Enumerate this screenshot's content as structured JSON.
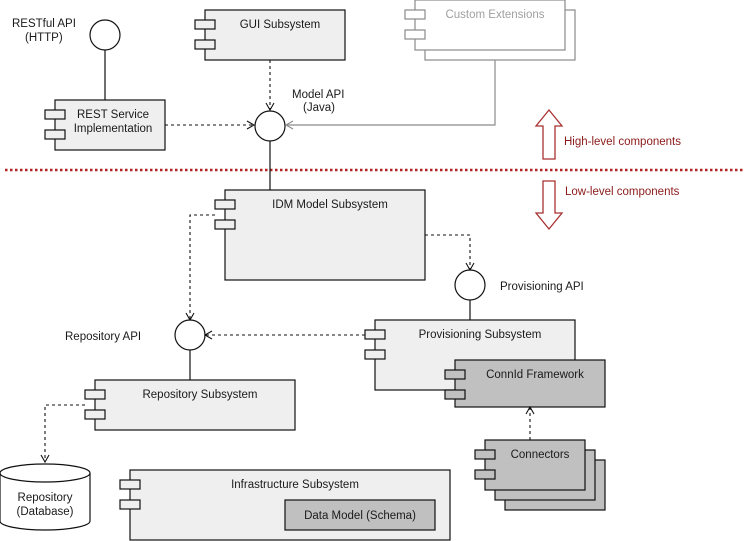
{
  "diagram": {
    "interfaces": {
      "restful_api": [
        "RESTful API",
        "(HTTP)"
      ],
      "model_api": [
        "Model API",
        "(Java)"
      ],
      "provisioning_api": "Provisioning API",
      "repository_api": "Repository API"
    },
    "components": {
      "gui": "GUI Subsystem",
      "custom_extensions": "Custom Extensions",
      "rest_service": [
        "REST Service",
        "Implementation"
      ],
      "idm_model": "IDM Model Subsystem",
      "provisioning": "Provisioning Subsystem",
      "connid": "ConnId Framework",
      "connectors": "Connectors",
      "repository": "Repository Subsystem",
      "infrastructure": "Infrastructure Subsystem",
      "data_model": "Data Model (Schema)"
    },
    "database": [
      "Repository",
      "(Database)"
    ],
    "layers": {
      "high": "High-level components",
      "low": "Low-level components"
    },
    "colors": {
      "component_fill": "#efefef",
      "nested_fill": "#c0c0c0",
      "ghost_stroke": "#8a8a8a",
      "divider": "#b22222",
      "layer_label": "#8b1a1a"
    }
  }
}
